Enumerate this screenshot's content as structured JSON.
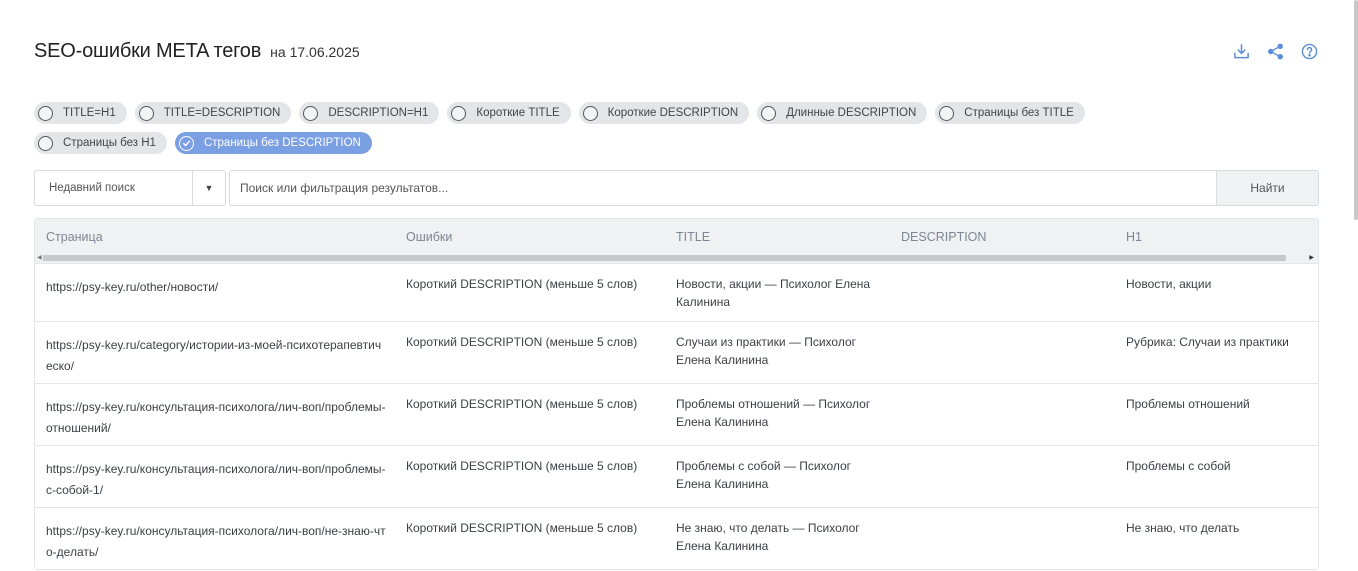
{
  "header": {
    "title": "SEO-ошибки META тегов",
    "date": "на 17.06.2025"
  },
  "tools": [
    {
      "name": "download-icon"
    },
    {
      "name": "share-icon"
    },
    {
      "name": "help-icon"
    }
  ],
  "filters": [
    {
      "label": "TITLE=H1",
      "active": false
    },
    {
      "label": "TITLE=DESCRIPTION",
      "active": false
    },
    {
      "label": "DESCRIPTION=H1",
      "active": false
    },
    {
      "label": "Короткие TITLE",
      "active": false
    },
    {
      "label": "Короткие DESCRIPTION",
      "active": false
    },
    {
      "label": "Длинные DESCRIPTION",
      "active": false
    },
    {
      "label": "Страницы без TITLE",
      "active": false
    },
    {
      "label": "Страницы без H1",
      "active": false
    },
    {
      "label": "Страницы без DESCRIPTION",
      "active": true
    }
  ],
  "search": {
    "recent_label": "Недавний поиск",
    "placeholder": "Поиск или фильтрация результатов...",
    "find_label": "Найти"
  },
  "table": {
    "columns": [
      "Страница",
      "Ошибки",
      "TITLE",
      "DESCRIPTION",
      "H1"
    ],
    "rows": [
      {
        "page": "https://psy-key.ru/other/новости/",
        "error": "Короткий DESCRIPTION (меньше 5 слов)",
        "title": "Новости, акции — Психолог Елена Калинина",
        "description": "",
        "h1": "Новости, акции"
      },
      {
        "page": "https://psy-key.ru/category/истории-из-моей-психотерапевтическо/",
        "error": "Короткий DESCRIPTION (меньше 5 слов)",
        "title": "Случаи из практики — Психолог Елена Калинина",
        "description": "",
        "h1": "Рубрика: Случаи из практики"
      },
      {
        "page": "https://psy-key.ru/консультация-психолога/лич-воп/проблемы-отношений/",
        "error": "Короткий DESCRIPTION (меньше 5 слов)",
        "title": "Проблемы отношений — Психолог Елена Калинина",
        "description": "",
        "h1": "Проблемы отношений"
      },
      {
        "page": "https://psy-key.ru/консультация-психолога/лич-воп/проблемы-с-собой-1/",
        "error": "Короткий DESCRIPTION (меньше 5 слов)",
        "title": "Проблемы с собой — Психолог Елена Калинина",
        "description": "",
        "h1": "Проблемы с собой"
      },
      {
        "page": "https://psy-key.ru/консультация-психолога/лич-воп/не-знаю-что-делать/",
        "error": "Короткий DESCRIPTION (меньше 5 слов)",
        "title": "Не знаю, что делать — Психолог Елена Калинина",
        "description": "",
        "h1": "Не знаю, что делать"
      }
    ]
  },
  "colors": {
    "accent": "#7b9fe3",
    "icon": "#5b8ed6"
  }
}
